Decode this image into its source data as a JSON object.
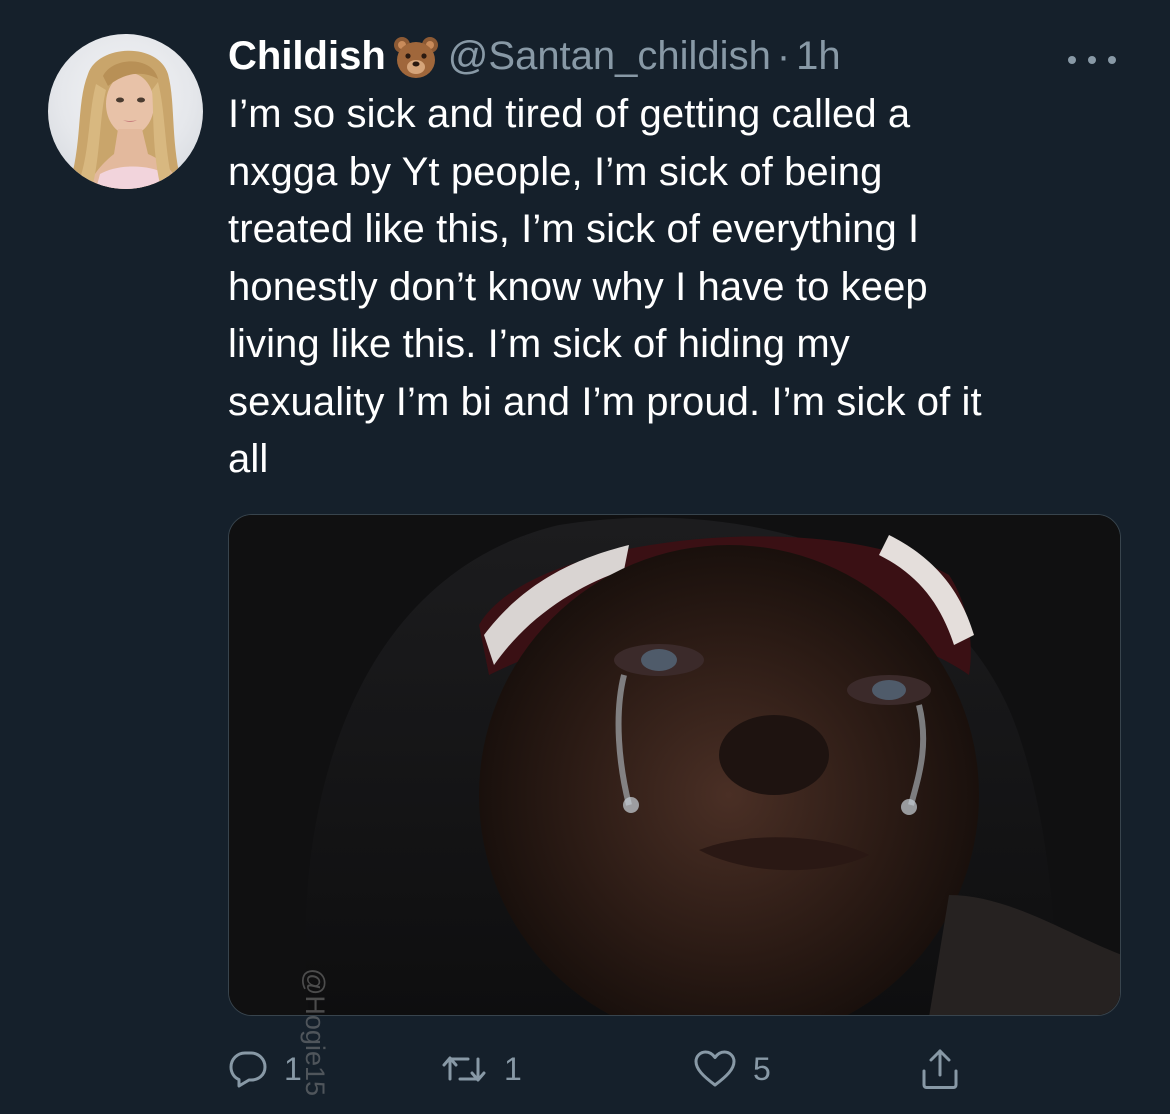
{
  "tweet": {
    "display_name": "Childish",
    "name_emoji": "bear-face",
    "handle": "@Santan_childish",
    "separator": "·",
    "time": "1h",
    "text": "I’m so sick and tired of getting called a\nnxgga by Yt people, I’m sick of being\ntreated like this, I’m sick of everything I\nhonestly don’t know why I have to keep\nliving like this. I’m sick of hiding my\nsexuality I’m bi and I’m proud. I’m sick of it\nall",
    "media_watermark": "@Hogie15",
    "actions": {
      "reply_count": "1",
      "retweet_count": "1",
      "like_count": "5"
    }
  },
  "icons": {
    "more": "more-horizontal-icon",
    "reply": "reply-bubble-icon",
    "retweet": "retweet-icon",
    "like": "heart-icon",
    "share": "share-upload-icon"
  },
  "colors": {
    "background": "#15202b",
    "text_primary": "#ffffff",
    "text_secondary": "#8899a6",
    "border": "#38444d"
  }
}
